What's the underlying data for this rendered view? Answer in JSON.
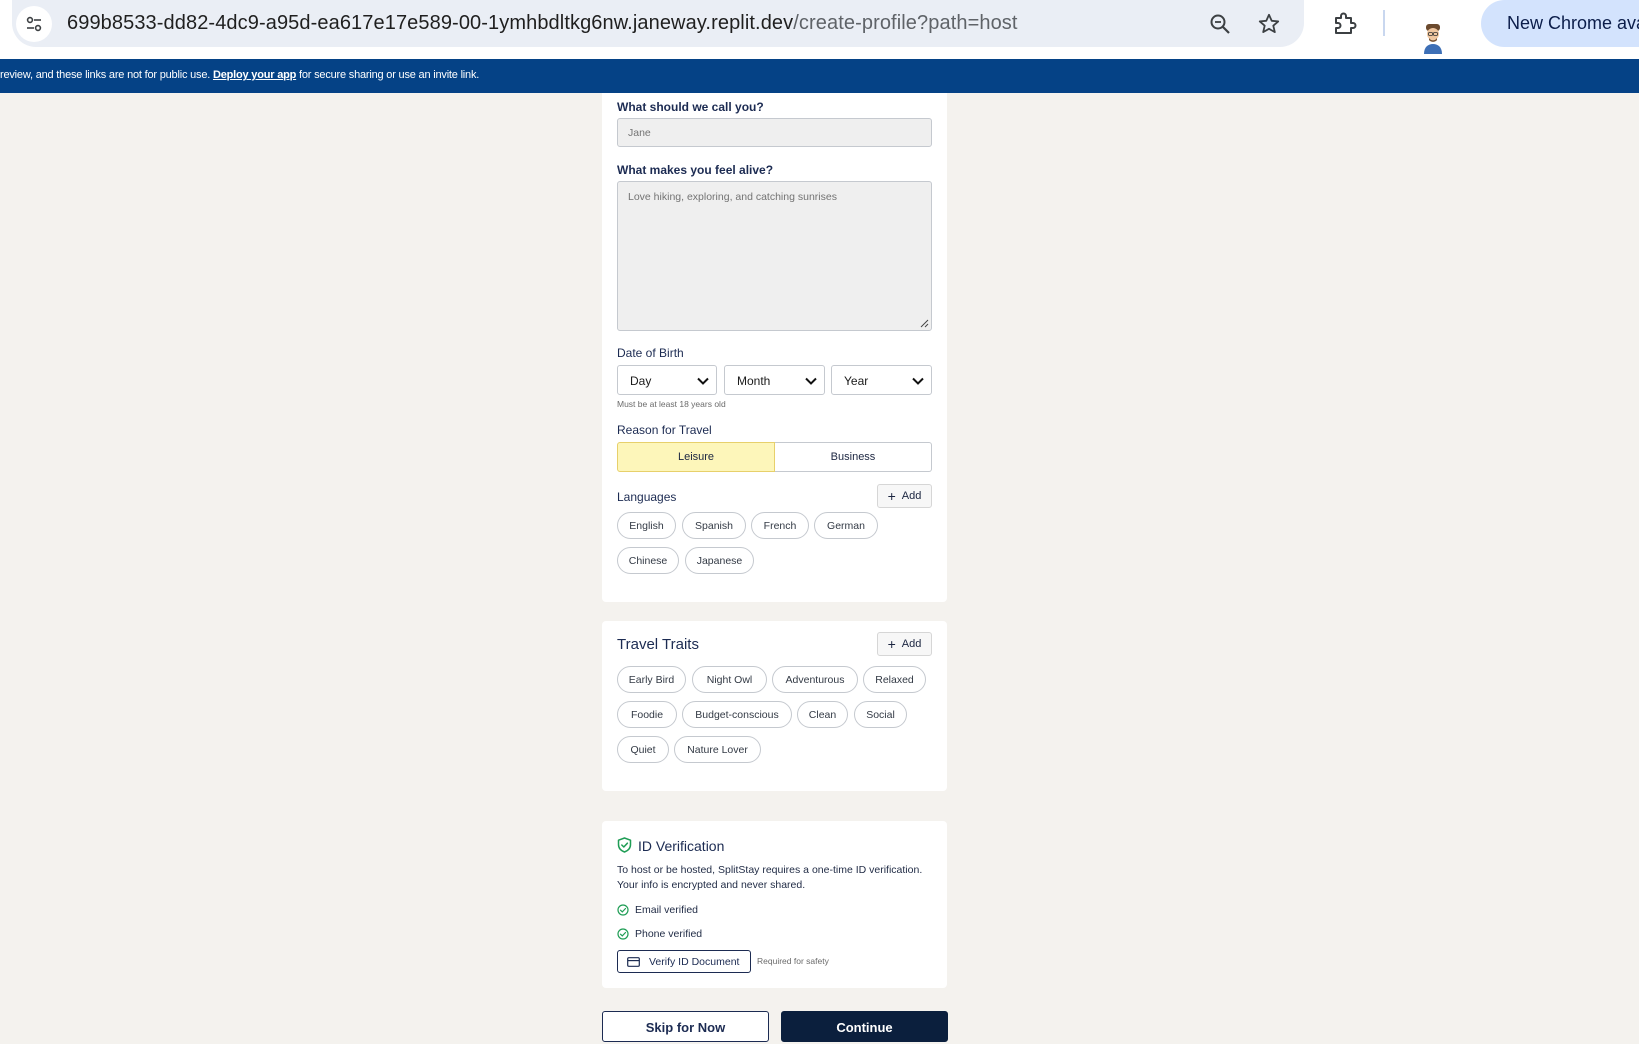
{
  "browser": {
    "url_host": "699b8533-dd82-4dc9-a95d-ea617e17e589-00-1ymhbdltkg6nw.janeway.replit.dev",
    "url_path": "/create-profile?path=host",
    "update_label": "New Chrome available"
  },
  "banner": {
    "text_before": "review, and these links are not for public use. ",
    "link_text": "Deploy your app",
    "text_after": " for secure sharing or use an invite link."
  },
  "profile": {
    "name_label": "What should we call you?",
    "name_placeholder": "Jane",
    "alive_label": "What makes you feel alive?",
    "alive_placeholder": "Love hiking, exploring, and catching sunrises",
    "dob_label": "Date of Birth",
    "dob_selects": [
      "Day",
      "Month",
      "Year"
    ],
    "dob_hint": "Must be at least 18 years old",
    "travel_reason_label": "Reason for Travel",
    "travel_reasons": [
      "Leisure",
      "Business"
    ],
    "travel_reason_selected": "Leisure",
    "languages_label": "Languages",
    "add_label": "Add",
    "languages": [
      "English",
      "Spanish",
      "French",
      "German",
      "Chinese",
      "Japanese"
    ]
  },
  "traits": {
    "title": "Travel Traits",
    "add_label": "Add",
    "items": [
      "Early Bird",
      "Night Owl",
      "Adventurous",
      "Relaxed",
      "Foodie",
      "Budget-conscious",
      "Clean",
      "Social",
      "Quiet",
      "Nature Lover"
    ]
  },
  "verification": {
    "title": "ID Verification",
    "description": "To host or be hosted, SplitStay requires a one-time ID verification. Your info is encrypted and never shared.",
    "checks": [
      "Email verified",
      "Phone verified"
    ],
    "verify_button": "Verify ID Document",
    "verify_note": "Required for safety",
    "accent_color": "#1f9d55"
  },
  "actions": {
    "skip_label": "Skip for Now",
    "continue_label": "Continue"
  }
}
